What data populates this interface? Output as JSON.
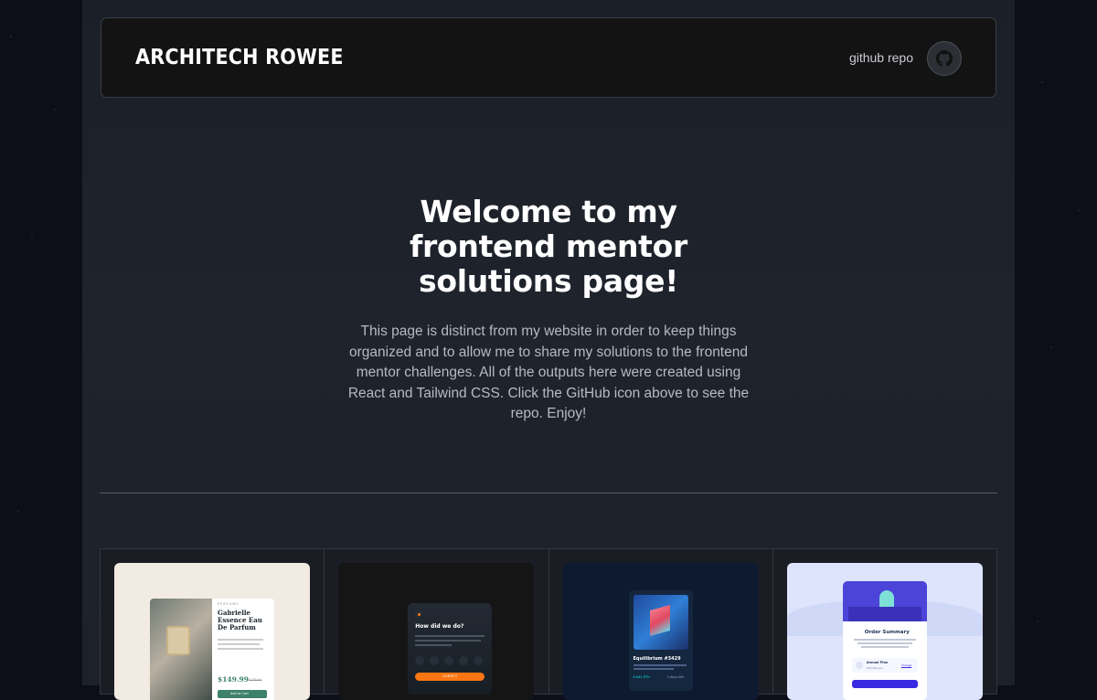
{
  "navbar": {
    "brand": "ARCHITECH ROWEE",
    "repo_label": "github repo",
    "github_icon": "github-icon"
  },
  "hero": {
    "title": "Welcome to my frontend mentor solutions page!",
    "description": "This page is distinct from my website in order to keep things organized and to allow me to share my solutions to the frontend mentor challenges. All of the outputs here were created using React and Tailwind CSS. Click the GitHub icon above to see the repo. Enjoy!"
  },
  "thumbnails": [
    {
      "kind": "product-preview-card",
      "category": "PERFUME",
      "title": "Gabrielle Essence Eau De Parfum",
      "price": "$149.99",
      "old_price": "$169.99",
      "cta": "Add to Cart"
    },
    {
      "kind": "rating-component",
      "title": "How did we do?",
      "ratings": [
        "1",
        "2",
        "3",
        "4",
        "5"
      ],
      "cta": "SUBMIT"
    },
    {
      "kind": "nft-preview-card",
      "title": "Equilibrium #3429",
      "price": "0.041 ETH",
      "time": "3 days left"
    },
    {
      "kind": "order-summary",
      "title": "Order Summary",
      "plan": "Annual Plan",
      "price": "$59.99/year",
      "change": "Change"
    }
  ],
  "colors": {
    "page_bg": "#0c0f17",
    "panel_bg": "#1f232c",
    "navbar_bg": "#131313",
    "accent_orange": "#fc7614",
    "accent_green": "#3d8168",
    "accent_purple": "#382ae1"
  }
}
